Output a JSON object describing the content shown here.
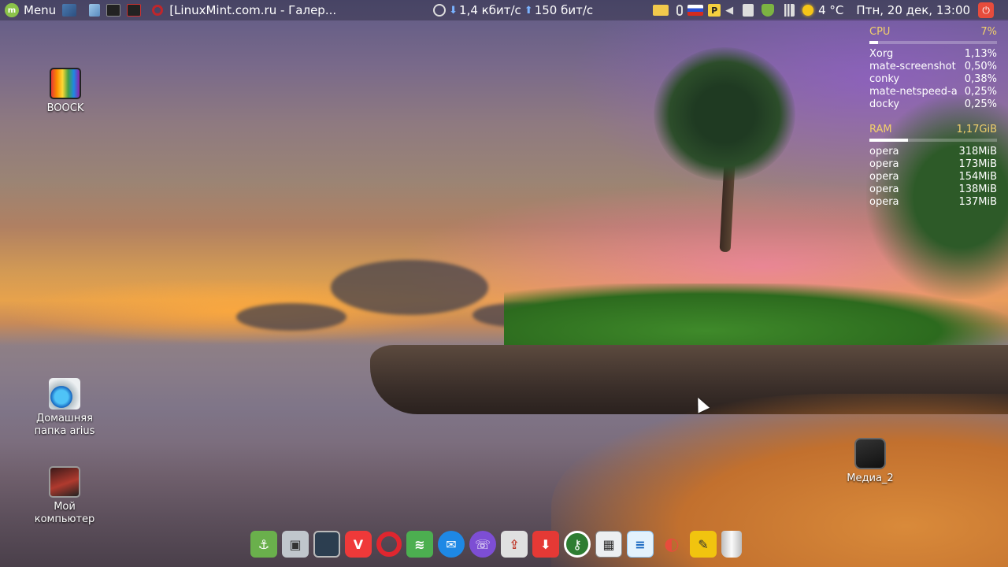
{
  "top_panel": {
    "menu_label": "Menu",
    "window_title": "[LinuxMint.com.ru - Галер...",
    "net_down": "1,4 кбит/с",
    "net_up": "150 бит/с",
    "weather": "4 °C",
    "clock": "Птн, 20 дек, 13:00"
  },
  "conky": {
    "cpu_label": "CPU",
    "cpu_value": "7%",
    "cpu_bar_fraction": 0.07,
    "processes": [
      {
        "name": "Xorg",
        "value": "1,13%"
      },
      {
        "name": "mate-screenshot",
        "value": "0,50%"
      },
      {
        "name": "conky",
        "value": "0,38%"
      },
      {
        "name": "mate-netspeed-a",
        "value": "0,25%"
      },
      {
        "name": "docky",
        "value": "0,25%"
      }
    ],
    "ram_label": "RAM",
    "ram_value": "1,17GiB",
    "ram_bar_fraction": 0.3,
    "memory": [
      {
        "name": "opera",
        "value": "318MiB"
      },
      {
        "name": "opera",
        "value": "173MiB"
      },
      {
        "name": "opera",
        "value": "154MiB"
      },
      {
        "name": "opera",
        "value": "138MiB"
      },
      {
        "name": "opera",
        "value": "137MiB"
      }
    ]
  },
  "desktop": {
    "boock": "BOOCK",
    "home_line1": "Домашняя",
    "home_line2": "папка arius",
    "computer_line1": "Мой",
    "computer_line2": "компьютер",
    "media": "Медиа_2"
  }
}
